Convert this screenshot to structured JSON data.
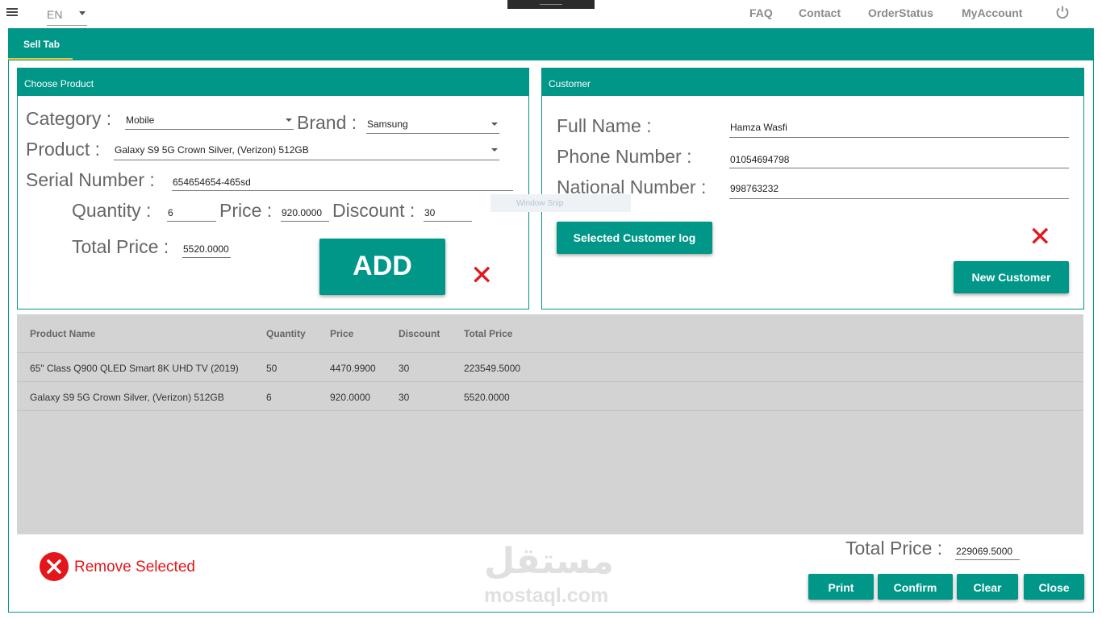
{
  "topbar": {
    "language": "EN",
    "nav": [
      "FAQ",
      "Contact",
      "OrderStatus",
      "MyAccount"
    ]
  },
  "tabs": [
    {
      "label": "Sell Tab"
    }
  ],
  "choose_product": {
    "title": "Choose Product",
    "category_label": "Category :",
    "category_value": "Mobile",
    "brand_label": "Brand :",
    "brand_value": "Samsung",
    "product_label": "Product :",
    "product_value": "Galaxy S9 5G Crown Silver, (Verizon) 512GB",
    "serial_label": "Serial Number :",
    "serial_value": "654654654-465sd",
    "quantity_label": "Quantity :",
    "quantity_value": "6",
    "price_label": "Price :",
    "price_value": "920.0000",
    "discount_label": "Discount :",
    "discount_value": "30",
    "total_label": "Total Price :",
    "total_value": "5520.0000",
    "add_label": "ADD"
  },
  "customer": {
    "title": "Customer",
    "fullname_label": "Full Name :",
    "fullname_value": "Hamza Wasfi",
    "phone_label": "Phone Number :",
    "phone_value": "01054694798",
    "national_label": "National Number :",
    "national_value": "998763232",
    "selected_log_label": "Selected Customer log",
    "new_customer_label": "New Customer"
  },
  "snip_overlay": "Window Snip",
  "grid": {
    "columns": [
      "Product Name",
      "Quantity",
      "Price",
      "Discount",
      "Total Price"
    ],
    "rows": [
      [
        "65\" Class Q900 QLED Smart 8K UHD TV (2019)",
        "50",
        "4470.9900",
        "30",
        "223549.5000"
      ],
      [
        "Galaxy S9 5G Crown Silver, (Verizon) 512GB",
        "6",
        "920.0000",
        "30",
        "5520.0000"
      ]
    ]
  },
  "footer": {
    "remove_label": "Remove Selected",
    "total_label": "Total Price :",
    "total_value": "229069.5000",
    "buttons": [
      "Print",
      "Confirm",
      "Clear",
      "Close"
    ]
  },
  "watermark": {
    "arabic": "مستقل",
    "latin": "mostaql.com"
  },
  "colors": {
    "accent": "#009688",
    "danger": "#e3161b",
    "grid_bg": "#d3d3d3",
    "tab_indicator": "#e7c83e"
  },
  "icons": [
    "hamburger-menu-icon",
    "chevron-down-icon",
    "power-icon",
    "close-x-icon",
    "remove-circle-icon"
  ]
}
